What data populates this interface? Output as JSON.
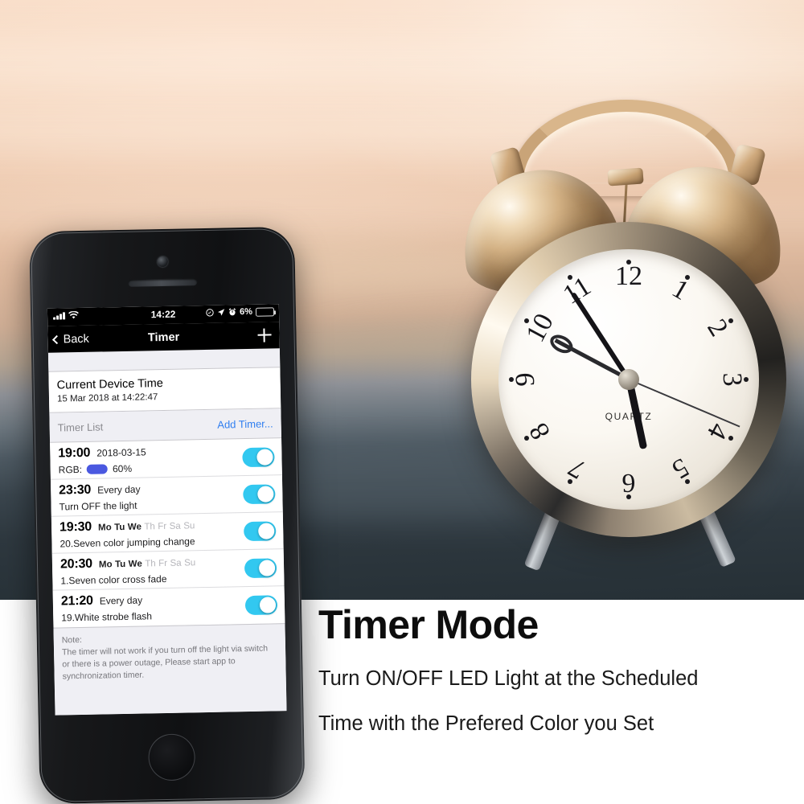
{
  "phone": {
    "status_bar": {
      "signal_icon": "cellular-signal-icon",
      "wifi_icon": "wifi-icon",
      "time": "14:22",
      "do_not_disturb_icon": "do-not-disturb-icon",
      "location_icon": "location-arrow-icon",
      "alarm_icon": "alarm-clock-icon",
      "battery_percent": "6%",
      "battery_icon": "battery-low-icon",
      "battery_level": 6,
      "battery_color": "#f5c518"
    },
    "nav_bar": {
      "back_label": "Back",
      "title": "Timer",
      "add_icon": "plus-icon"
    },
    "device_time": {
      "title": "Current Device Time",
      "value": "15 Mar 2018 at 14:22:47"
    },
    "list_header": {
      "label": "Timer List",
      "add_link": "Add Timer...",
      "add_link_color": "#2f7ef0"
    },
    "timers": [
      {
        "time": "19:00",
        "when": "2018-03-15",
        "days": null,
        "sub": "RGB:",
        "swatch_color": "#4a58e0",
        "brightness": "60%",
        "enabled": true
      },
      {
        "time": "23:30",
        "when": "Every day",
        "days": null,
        "sub": "Turn OFF the light",
        "swatch_color": null,
        "brightness": null,
        "enabled": true
      },
      {
        "time": "19:30",
        "when": null,
        "days": [
          {
            "label": "Mo",
            "active": true
          },
          {
            "label": "Tu",
            "active": true
          },
          {
            "label": "We",
            "active": true
          },
          {
            "label": "Th",
            "active": false
          },
          {
            "label": "Fr",
            "active": false
          },
          {
            "label": "Sa",
            "active": false
          },
          {
            "label": "Su",
            "active": false
          }
        ],
        "sub": "20.Seven color jumping change",
        "swatch_color": null,
        "brightness": null,
        "enabled": true
      },
      {
        "time": "20:30",
        "when": null,
        "days": [
          {
            "label": "Mo",
            "active": true
          },
          {
            "label": "Tu",
            "active": true
          },
          {
            "label": "We",
            "active": true
          },
          {
            "label": "Th",
            "active": false
          },
          {
            "label": "Fr",
            "active": false
          },
          {
            "label": "Sa",
            "active": false
          },
          {
            "label": "Su",
            "active": false
          }
        ],
        "sub": "1.Seven color cross fade",
        "swatch_color": null,
        "brightness": null,
        "enabled": true
      },
      {
        "time": "21:20",
        "when": "Every day",
        "days": null,
        "sub": "19.White strobe flash",
        "swatch_color": null,
        "brightness": null,
        "enabled": true
      }
    ],
    "toggle_on_color": "#32c8f0",
    "note": "Note:\nThe timer will not work if you turn off the light via switch or there is a power outage, Please start app to synchronization timer."
  },
  "marketing": {
    "headline": "Timer Mode",
    "line1": "Turn ON/OFF LED Light at the Scheduled",
    "line2": "Time with the Prefered Color you Set"
  },
  "photo": {
    "subject": "twin-bell-alarm-clock",
    "dial_brand": "QUARTZ",
    "numerals": [
      "12",
      "1",
      "2",
      "3",
      "4",
      "5",
      "6",
      "7",
      "8",
      "9",
      "10",
      "11"
    ]
  }
}
